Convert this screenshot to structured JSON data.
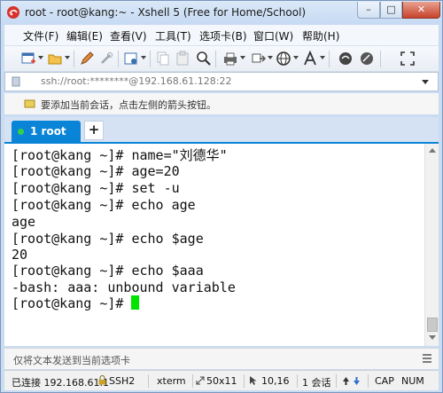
{
  "window": {
    "title": "root - root@kang:~ - Xshell 5 (Free for Home/School)",
    "min": "–",
    "max": "□",
    "close": "✕"
  },
  "menu": [
    "文件(F)",
    "编辑(E)",
    "查看(V)",
    "工具(T)",
    "选项卡(B)",
    "窗口(W)",
    "帮助(H)"
  ],
  "toolbar": {
    "icons": [
      "new-session-icon",
      "open-folder-icon",
      "edit-icon",
      "tool-icon",
      "properties-icon",
      "copy-icon",
      "paste-icon",
      "find-icon",
      "print-icon",
      "transfer-icon",
      "globe-icon",
      "font-icon",
      "xftp-icon",
      "xmanager-icon",
      "fullscreen-icon"
    ]
  },
  "address": {
    "value": "ssh://root:********@192.168.61.128:22"
  },
  "hint": {
    "text": "要添加当前会话，点击左侧的箭头按钮。"
  },
  "tabs": [
    {
      "label": "1 root",
      "active": true
    }
  ],
  "tab_add": "+",
  "terminal": {
    "lines": [
      "[root@kang ~]# name=\"刘德华\"",
      "[root@kang ~]# age=20",
      "[root@kang ~]# set -u",
      "[root@kang ~]# echo age",
      "age",
      "[root@kang ~]# echo $age",
      "20",
      "[root@kang ~]# echo $aaa",
      "-bash: aaa: unbound variable"
    ],
    "prompt": "[root@kang ~]# "
  },
  "compose": {
    "placeholder": "仅将文本发送到当前选项卡"
  },
  "status": {
    "connection": "已连接 192.168.61.1",
    "protocol": "SSH2",
    "terminal_type": "xterm",
    "size": "50x11",
    "cursor_pos": "10,16",
    "sessions": "1 会话",
    "caps": "CAP",
    "num": "NUM"
  },
  "colors": {
    "accent": "#0a84d6",
    "cursor": "#00e400",
    "active_dot": "#35d04a"
  }
}
